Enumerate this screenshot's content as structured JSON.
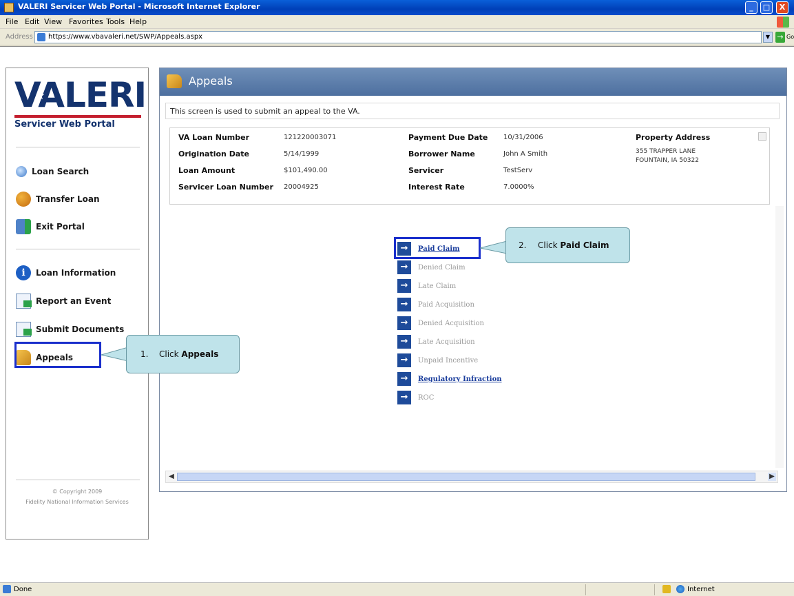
{
  "window": {
    "title": "VALERI Servicer Web Portal - Microsoft Internet Explorer",
    "min": "_",
    "max": "□",
    "close": "X"
  },
  "menu": [
    "File",
    "Edit",
    "View",
    "Favorites",
    "Tools",
    "Help"
  ],
  "address": {
    "label": "Address",
    "url": "https://www.vbavaleri.net/SWP/Appeals.aspx",
    "go": "Go"
  },
  "sidebar": {
    "logo_text": "VALERI",
    "logo_sub": "Servicer Web Portal",
    "items": [
      {
        "label": "Loan Search"
      },
      {
        "label": "Transfer Loan"
      },
      {
        "label": "Exit Portal"
      },
      {
        "label": "Loan Information"
      },
      {
        "label": "Report an Event"
      },
      {
        "label": "Submit Documents"
      },
      {
        "label": "Appeals"
      }
    ],
    "copyright_1": "© Copyright 2009",
    "copyright_2": "Fidelity National Information Services"
  },
  "main": {
    "title": "Appeals",
    "intro": "This screen is used to submit an appeal to the VA.",
    "info": {
      "va_loan_number_label": "VA Loan Number",
      "va_loan_number": "121220003071",
      "origination_date_label": "Origination Date",
      "origination_date": "5/14/1999",
      "loan_amount_label": "Loan Amount",
      "loan_amount": "$101,490.00",
      "servicer_loan_number_label": "Servicer Loan Number",
      "servicer_loan_number": "20004925",
      "payment_due_date_label": "Payment Due Date",
      "payment_due_date": "10/31/2006",
      "borrower_name_label": "Borrower Name",
      "borrower_name": "John A Smith",
      "servicer_label": "Servicer",
      "servicer": "TestServ",
      "interest_rate_label": "Interest Rate",
      "interest_rate": "7.0000%",
      "property_address_label": "Property Address",
      "property_address_1": "355 TRAPPER LANE",
      "property_address_2": "FOUNTAIN, IA 50322"
    },
    "actions": [
      {
        "label": "Paid Claim",
        "enabled": true
      },
      {
        "label": "Denied Claim",
        "enabled": false
      },
      {
        "label": "Late Claim",
        "enabled": false
      },
      {
        "label": "Paid Acquisition",
        "enabled": false
      },
      {
        "label": "Denied Acquisition",
        "enabled": false
      },
      {
        "label": "Late Acquisition",
        "enabled": false
      },
      {
        "label": "Unpaid Incentive",
        "enabled": false
      },
      {
        "label": "Regulatory Infraction",
        "enabled": true
      },
      {
        "label": "ROC",
        "enabled": false
      }
    ],
    "arrow_glyph": "→"
  },
  "callouts": {
    "one_num": "1.",
    "one_pre": "Click ",
    "one_bold": "Appeals",
    "two_num": "2.",
    "two_pre": "Click ",
    "two_bold": "Paid Claim"
  },
  "status": {
    "text": "Done",
    "zone": "Internet"
  },
  "colors": {
    "callout_fill": "#bfe3ea",
    "highlight_border": "#1a2fcc",
    "header_bg": "#4d6f9f",
    "link": "#1a3d9c"
  }
}
